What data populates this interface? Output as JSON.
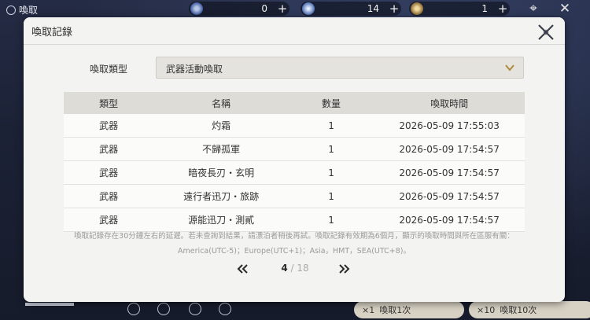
{
  "topbar": {
    "title": "喚取",
    "resources": [
      {
        "icon": "orb-currency-icon",
        "value": "0"
      },
      {
        "icon": "star-ticket-icon",
        "value": "14"
      },
      {
        "icon": "feather-ticket-icon",
        "value": "1"
      }
    ]
  },
  "bottom": {
    "pull1_count": "×1",
    "pull1_label": "喚取1次",
    "pull10_count": "×10",
    "pull10_label": "喚取10次"
  },
  "modal": {
    "title": "喚取記錄",
    "filter_label": "喚取類型",
    "filter_value": "武器活動喚取",
    "columns": [
      "類型",
      "名稱",
      "數量",
      "喚取時間"
    ],
    "rows": [
      {
        "type": "武器",
        "name": "灼霜",
        "qty": "1",
        "time": "2026-05-09 17:55:03",
        "rarity": "gold"
      },
      {
        "type": "武器",
        "name": "不歸孤軍",
        "qty": "1",
        "time": "2026-05-09 17:54:57",
        "rarity": "purple"
      },
      {
        "type": "武器",
        "name": "暗夜長刃・玄明",
        "qty": "1",
        "time": "2026-05-09 17:54:57",
        "rarity": "normal"
      },
      {
        "type": "武器",
        "name": "遠行者迅刀・旅跡",
        "qty": "1",
        "time": "2026-05-09 17:54:57",
        "rarity": "normal"
      },
      {
        "type": "武器",
        "name": "源能迅刀・測貳",
        "qty": "1",
        "time": "2026-05-09 17:54:57",
        "rarity": "normal"
      }
    ],
    "note_line1": "喚取記錄存在30分鐘左右的延遲。若未查詢到結果，請漂泊者稍後再試。喚取記錄有效期為6個月，顯示的喚取時間與所在區服有關：",
    "note_line2": "America(UTC-5)；Europe(UTC+1)；Asia，HMT，SEA(UTC+8)。",
    "pager": {
      "current": "4",
      "separator": "/",
      "total": "18"
    }
  },
  "colors": {
    "gold": "#d2a22b",
    "purple": "#9b6ab3",
    "chevron": "#b08a3a"
  }
}
